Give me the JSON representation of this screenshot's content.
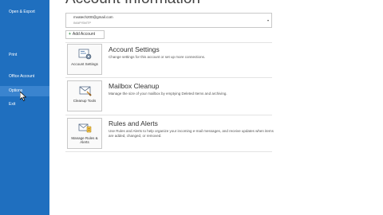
{
  "sidebar": {
    "items": [
      {
        "label": "Open & Export"
      },
      {
        "label": "Print"
      },
      {
        "label": "Office Account"
      },
      {
        "label": "Options"
      },
      {
        "label": "Exit"
      }
    ]
  },
  "page": {
    "title": "Account Information"
  },
  "account": {
    "email": "mvatech200@gmail.com",
    "type": "IMAP/SMTP",
    "add_label": "Add Account"
  },
  "sections": [
    {
      "tile_label": "Account Settings",
      "title": "Account Settings",
      "description": "Change settings for this account or set up more connections."
    },
    {
      "tile_label": "Cleanup Tools",
      "title": "Mailbox Cleanup",
      "description": "Manage the size of your mailbox by emptying Deleted Items and archiving."
    },
    {
      "tile_label": "Manage Rules & Alerts",
      "title": "Rules and Alerts",
      "description": "Use Rules and Alerts to help organize your incoming e-mail messages, and receive updates when items are added, changed, or removed."
    }
  ],
  "colors": {
    "sidebar": "#1f6fbf",
    "sidebar_active": "#3a84cf"
  }
}
